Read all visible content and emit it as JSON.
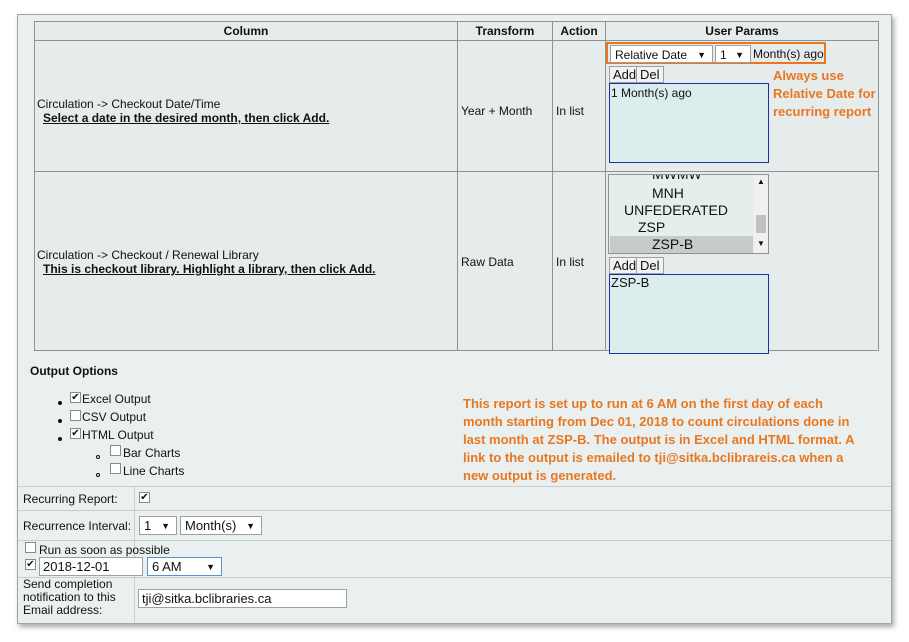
{
  "table": {
    "headers": [
      "Column",
      "Transform",
      "Action",
      "User Params"
    ],
    "rows": [
      {
        "column_name": "Circulation -> Checkout Date/Time",
        "column_hint": "Select a date in the desired month, then click Add.",
        "transform": "Year + Month",
        "action": "In list",
        "date_mode": "Relative Date",
        "amount": "1",
        "unit": "Month(s) ago",
        "add_label": "Add",
        "del_label": "Del",
        "values": [
          "1 Month(s) ago"
        ]
      },
      {
        "column_name": "Circulation -> Checkout / Renewal Library",
        "column_hint": "This is checkout library. Highlight a library, then click Add.",
        "transform": "Raw Data",
        "action": "In list",
        "library_options": [
          "MWMW",
          "MNH",
          "UNFEDERATED",
          "ZSP",
          "ZSP-B"
        ],
        "selected_library": "ZSP-B",
        "add_label": "Add",
        "del_label": "Del",
        "values": [
          "ZSP-B"
        ]
      }
    ]
  },
  "annotations": {
    "relative_date_note": [
      "Always use",
      "Relative Date for",
      "recurring report"
    ],
    "schedule_note": [
      "This report is set up to run at 6 AM on the first day of each",
      "month starting from Dec 01, 2018 to count circulations done in",
      "last  month at ZSP-B. The output is in Excel and HTML format. A",
      "link to the output is emailed to tji@sitka.bclibrareis.ca when a",
      "new output is generated."
    ]
  },
  "output_options": {
    "title": "Output Options",
    "excel": {
      "label": "Excel Output",
      "checked": true
    },
    "csv": {
      "label": "CSV Output",
      "checked": false
    },
    "html": {
      "label": "HTML Output",
      "checked": true
    },
    "bar_charts": {
      "label": "Bar Charts",
      "checked": false
    },
    "line_charts": {
      "label": "Line Charts",
      "checked": false
    }
  },
  "schedule": {
    "recurring_label": "Recurring Report:",
    "recurring_checked": true,
    "interval_label": "Recurrence Interval:",
    "interval_value": "1",
    "interval_unit": "Month(s)",
    "run_asap_label": "Run as soon as possible",
    "run_asap_checked": false,
    "date_checked": true,
    "start_date": "2018-12-01",
    "start_time": "6 AM",
    "email_label": [
      "Send completion",
      "notification to this",
      "Email address:"
    ],
    "email_value": "tji@sitka.bclibraries.ca"
  },
  "colors": {
    "annotation": "#e87722",
    "highlight_border": "#e87722",
    "list_border": "#1a2fa8"
  }
}
